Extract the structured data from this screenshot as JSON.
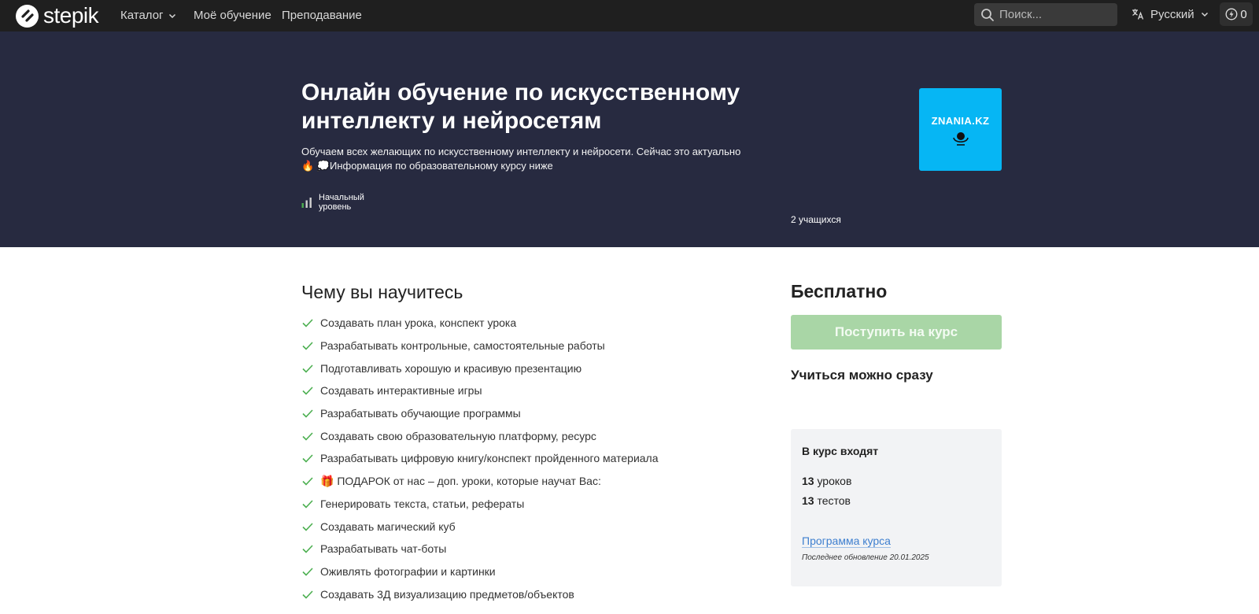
{
  "nav": {
    "brand": "stepik",
    "catalog": "Каталог",
    "my_learning": "Моё обучение",
    "teaching": "Преподавание",
    "search_placeholder": "Поиск...",
    "language": "Русский",
    "energy_count": "0"
  },
  "hero": {
    "title": "Онлайн обучение по искусственному интеллекту и нейросетям",
    "description": "Обучаем всех желающих по искусственному интеллекту и нейросети. Сейчас это актуально 🔥 💭Информация по образовательному курсу ниже",
    "level": "Начальный уровень",
    "students": "2 учащихся",
    "logo_text": "ZNANIA.KZ"
  },
  "learn": {
    "title": "Чему вы научитесь",
    "items": [
      "Создавать план урока, конспект урока",
      "Разрабатывать контрольные, самостоятельные работы",
      "Подготавливать хорошую и красивую презентацию",
      "Создавать интерактивные игры",
      "Разрабатывать обучающие программы",
      "Создавать свою образовательную платформу, ресурс",
      "Разрабатывать цифровую книгу/конспект пройденного материала",
      "🎁 ПОДАРОК от нас – доп. уроки, которые научат Вас:",
      "Генерировать текста, статьи, рефераты",
      "Создавать магический куб",
      "Разрабатывать чат-боты",
      "Оживлять фотографии и картинки",
      "Создавать 3Д визуализацию предметов/объектов"
    ]
  },
  "sidebar": {
    "price": "Бесплатно",
    "enroll_label": "Поступить на курс",
    "start_now": "Учиться можно сразу",
    "includes_title": "В курс входят",
    "lessons_count": "13",
    "lessons_label": "уроков",
    "tests_count": "13",
    "tests_label": "тестов",
    "program_link": "Программа курса",
    "last_update": "Последнее обновление 20.01.2025"
  },
  "colors": {
    "nav_bg": "#1f1f1f",
    "hero_bg": "#272a40",
    "logo_bg": "#06b6f4",
    "check": "#4caf50",
    "enroll_bg": "#a9d6a6",
    "link": "#3e7fcf"
  },
  "icons": [
    "stepik-logo-icon",
    "chevron-down-icon",
    "search-icon",
    "translate-icon",
    "energy-icon",
    "level-bars-icon",
    "check-icon"
  ]
}
